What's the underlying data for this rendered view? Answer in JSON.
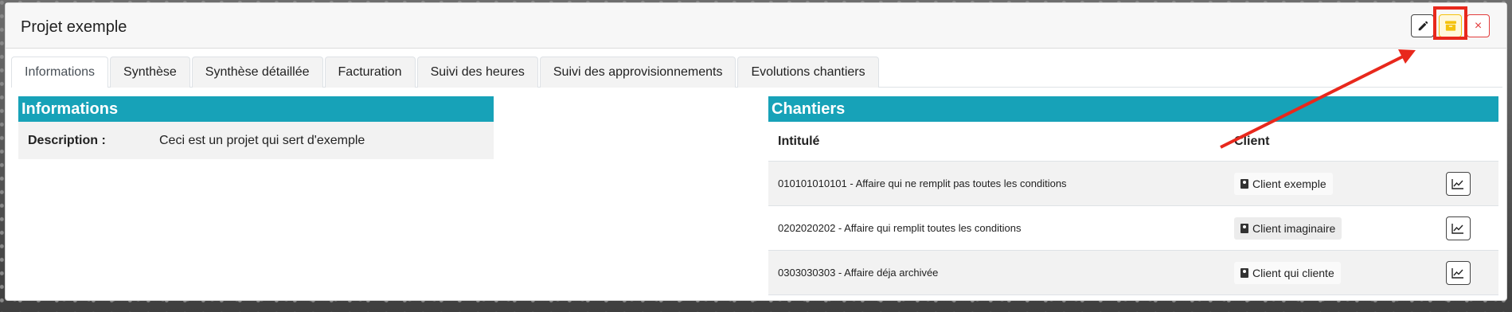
{
  "header": {
    "title": "Projet exemple",
    "edit_icon": "pencil-icon",
    "archive_icon": "archive-box-icon",
    "close_label": "×"
  },
  "tabs": [
    {
      "label": "Informations",
      "active": true
    },
    {
      "label": "Synthèse"
    },
    {
      "label": "Synthèse détaillée"
    },
    {
      "label": "Facturation"
    },
    {
      "label": "Suivi des heures"
    },
    {
      "label": "Suivi des approvisionnements"
    },
    {
      "label": "Evolutions chantiers"
    }
  ],
  "informations": {
    "title": "Informations",
    "description_label": "Description :",
    "description_value": "Ceci est un projet qui sert d'exemple"
  },
  "chantiers": {
    "title": "Chantiers",
    "columns": [
      "Intitulé",
      "Client"
    ],
    "rows": [
      {
        "intitule": "010101010101 - Affaire qui ne remplit pas toutes les conditions",
        "client": "Client exemple"
      },
      {
        "intitule": "0202020202 - Affaire qui remplit toutes les conditions",
        "client": "Client imaginaire"
      },
      {
        "intitule": "0303030303 - Affaire déja archivée",
        "client": "Client qui cliente"
      }
    ]
  },
  "colors": {
    "section_header": "#17a2b8",
    "annotation_red": "#e8281c",
    "archive_yellow": "#f4c20d",
    "close_red": "#e23b3b"
  }
}
